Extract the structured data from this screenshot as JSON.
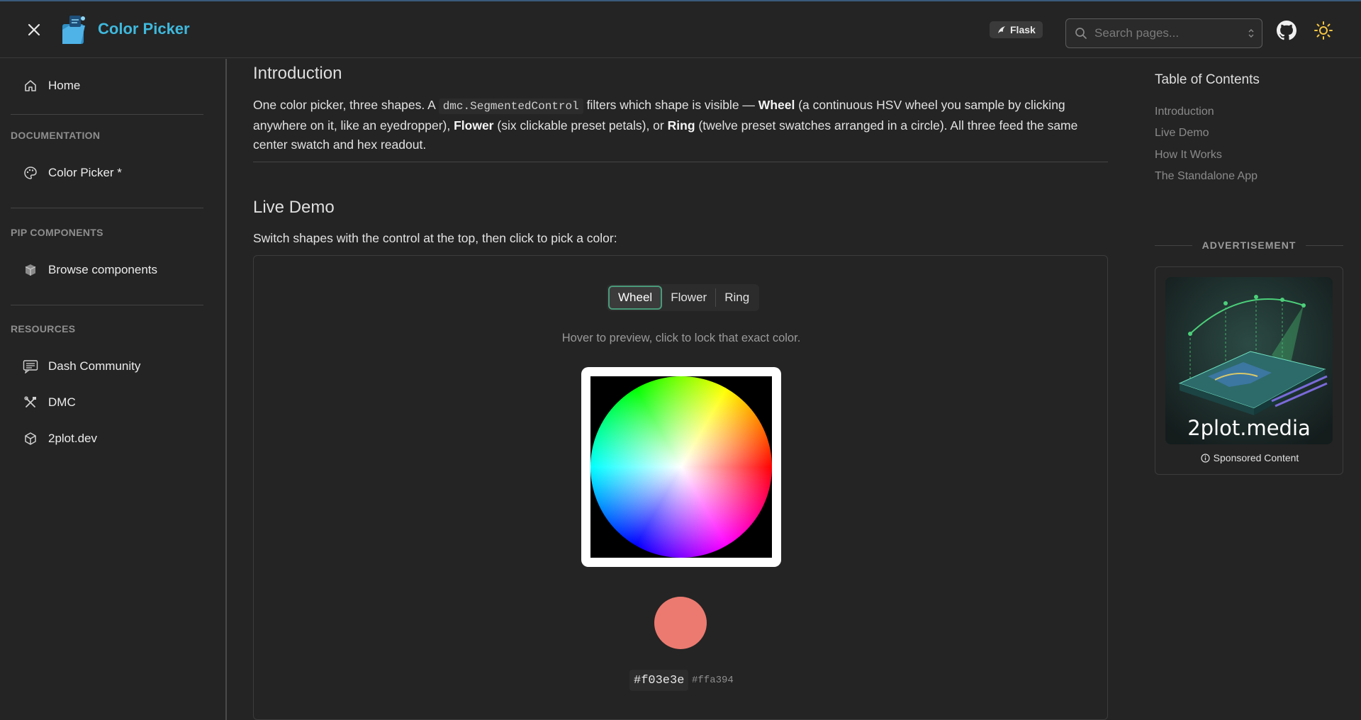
{
  "header": {
    "app_title": "Color Picker",
    "badge": "Flask",
    "search_placeholder": "Search pages..."
  },
  "sidebar": {
    "home": "Home",
    "sections": [
      {
        "label": "DOCUMENTATION",
        "items": [
          {
            "label": "Color Picker *",
            "icon": "palette-icon"
          }
        ]
      },
      {
        "label": "PIP COMPONENTS",
        "items": [
          {
            "label": "Browse components",
            "icon": "package-icon"
          }
        ]
      },
      {
        "label": "RESOURCES",
        "items": [
          {
            "label": "Dash Community",
            "icon": "chat-icon"
          },
          {
            "label": "DMC",
            "icon": "tools-icon"
          },
          {
            "label": "2plot.dev",
            "icon": "cube-icon"
          }
        ]
      }
    ]
  },
  "main": {
    "intro_heading": "Introduction",
    "intro_p1": "One color picker, three shapes. A",
    "intro_code": "dmc.SegmentedControl",
    "intro_p2": "filters which shape is visible —",
    "intro_wheel": "Wheel",
    "intro_p3": "(a continuous HSV wheel you sample by clicking anywhere on it, like an eyedropper),",
    "intro_flower": "Flower",
    "intro_p4": "(six clickable preset petals), or",
    "intro_ring": "Ring",
    "intro_p5": "(twelve preset swatches arranged in a circle). All three feed the same center swatch and hex readout.",
    "demo_heading": "Live Demo",
    "demo_desc": "Switch shapes with the control at the top, then click to pick a color:",
    "demo": {
      "tabs": [
        "Wheel",
        "Flower",
        "Ring"
      ],
      "active_tab": "Wheel",
      "hint": "Hover to preview, click to lock that exact color.",
      "selected_color": "#f03e3e",
      "hover_color": "#ffa394"
    }
  },
  "toc": {
    "title": "Table of Contents",
    "links": [
      "Introduction",
      "Live Demo",
      "How It Works",
      "The Standalone App"
    ]
  },
  "ad": {
    "label": "ADVERTISEMENT",
    "brand": "2plot.media",
    "sponsored": "Sponsored Content"
  },
  "colors": {
    "accent": "#3fb9dd",
    "active_tab_border": "#4a9a7a",
    "background": "#242424"
  }
}
